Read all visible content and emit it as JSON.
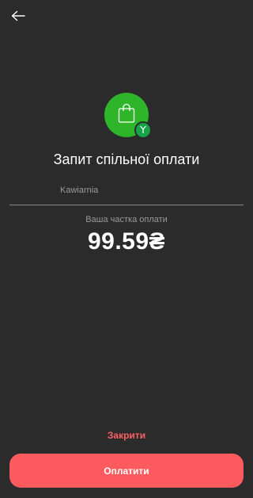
{
  "header": {
    "back_icon": "arrow-left-icon"
  },
  "hero": {
    "icon": "shopping-bag-icon",
    "badge_icon": "split-icon"
  },
  "title": "Запит спільної оплати",
  "merchant": {
    "value": "Kawiarnia"
  },
  "share": {
    "label": "Ваша частка оплати",
    "amount": "99.59₴"
  },
  "actions": {
    "close_label": "Закрити",
    "pay_label": "Оплатити"
  },
  "colors": {
    "background": "#2b2b2b",
    "hero_green": "#2fb52a",
    "badge_green": "#17a34a",
    "accent_red": "#fb6163",
    "button_red": "#fb5b5f"
  }
}
